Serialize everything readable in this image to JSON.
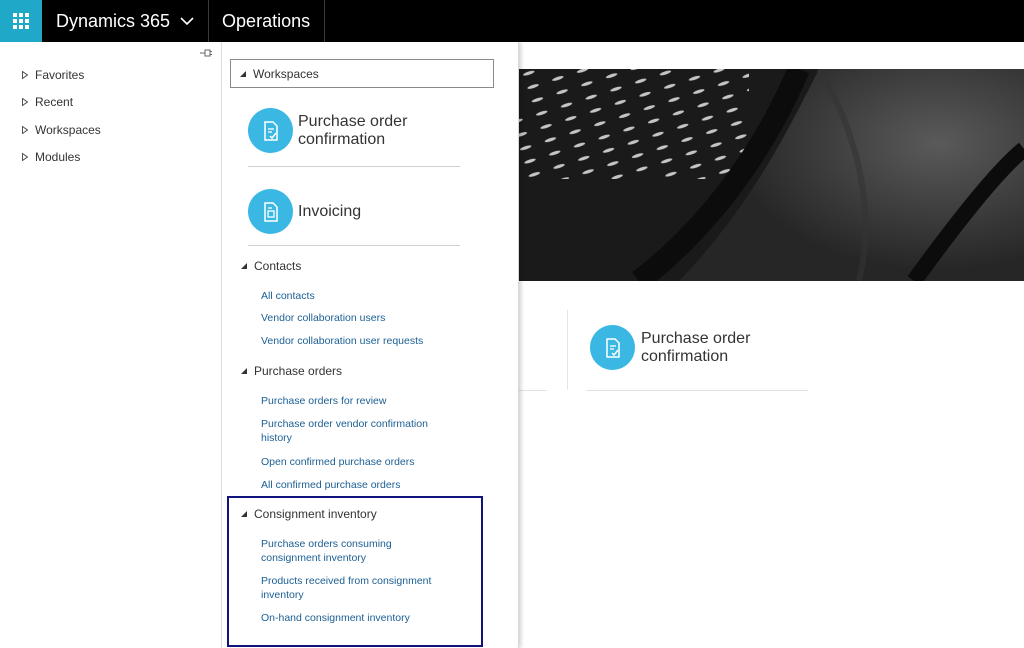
{
  "topbar": {
    "brand": "Dynamics 365",
    "app_name": "Operations"
  },
  "leftnav": {
    "items": [
      {
        "label": "Favorites"
      },
      {
        "label": "Recent"
      },
      {
        "label": "Workspaces"
      },
      {
        "label": "Modules"
      }
    ]
  },
  "flyout": {
    "header": "Workspaces",
    "tiles": [
      {
        "label": "Purchase order confirmation",
        "icon": "document-check-icon"
      },
      {
        "label": "Invoicing",
        "icon": "invoice-icon"
      }
    ],
    "sections": [
      {
        "title": "Contacts",
        "links": [
          "All contacts",
          "Vendor collaboration users",
          "Vendor collaboration user requests"
        ]
      },
      {
        "title": "Purchase orders",
        "links": [
          "Purchase orders for review",
          "Purchase order vendor confirmation history",
          "Open confirmed purchase orders",
          "All confirmed purchase orders"
        ]
      },
      {
        "title": "Consignment inventory",
        "links": [
          "Purchase orders consuming consignment inventory",
          "Products received from consignment inventory",
          "On-hand consignment inventory"
        ]
      }
    ]
  },
  "main": {
    "tile": {
      "label": "Purchase order confirmation",
      "icon": "document-check-icon"
    }
  },
  "colors": {
    "accent": "#3ab8e3",
    "waffle": "#1fa8c8",
    "link": "#1b5f94",
    "highlight_border": "#10137a",
    "topbar": "#000000"
  }
}
